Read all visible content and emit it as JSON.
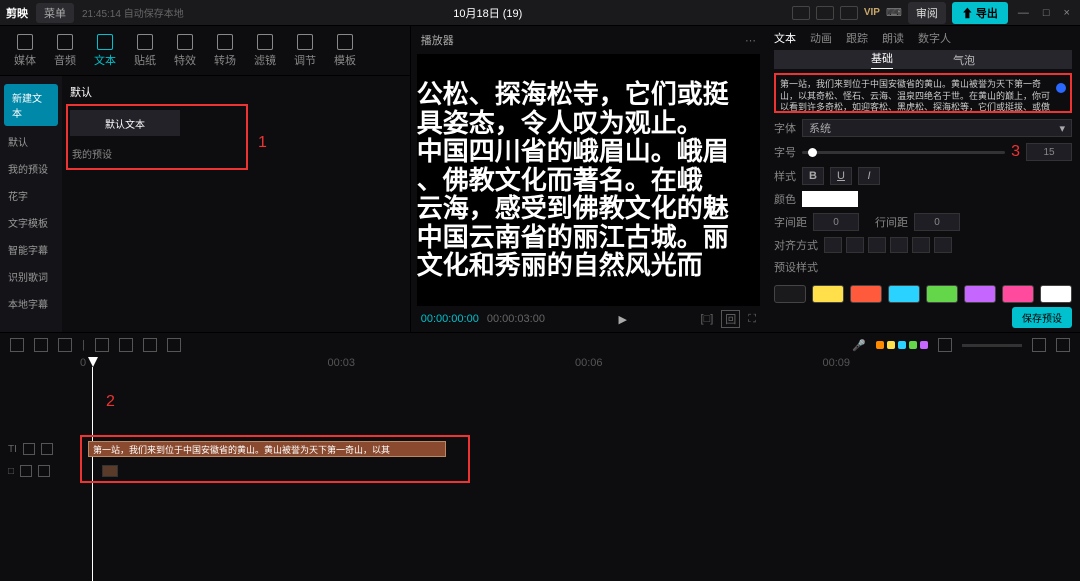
{
  "titlebar": {
    "logo": "剪映",
    "menu": "菜单",
    "autosave": "21:45:14 自动保存本地",
    "title": "10月18日 (19)",
    "vip": "VIP",
    "review": "审阅",
    "export": "导出"
  },
  "toolTabs": [
    "媒体",
    "音频",
    "文本",
    "贴纸",
    "特效",
    "转场",
    "滤镜",
    "调节",
    "模板"
  ],
  "toolActiveIndex": 2,
  "sideNav": [
    "新建文本",
    "默认",
    "我的预设",
    "花字",
    "文字模板",
    "智能字幕",
    "识别歌词",
    "本地字幕"
  ],
  "leftMain": {
    "tab": "默认",
    "card": "默认文本",
    "preset": "我的预设",
    "marker": "1"
  },
  "preview": {
    "title": "播放器",
    "lines": [
      "公松、探海松寺，它们或挺",
      "具姿态，令人叹为观止。",
      "中国四川省的峨眉山。峨眉",
      "、佛教文化而著名。在峨",
      "云海，感受到佛教文化的魅",
      "中国云南省的丽江古城。丽",
      "文化和秀丽的自然风光而"
    ],
    "cur": "00:00:00:00",
    "total": "00:00:03:00"
  },
  "right": {
    "tabs": [
      "文本",
      "动画",
      "跟踪",
      "朗读",
      "数字人"
    ],
    "sub1": "基础",
    "sub2": "气泡",
    "text": "第一站，我们来到位于中国安徽省的黄山。黄山被誉为天下第一奇山，以其奇松、怪石、云海、温泉四绝名于世。在黄山的巅上，你可以看到许多奇松，如迎客松、黑虎松、探海松等，它们或挺拔、或傲立、或横卧，各具姿态，令人叹为观止。\n第二站，我们来到位于中国四川省的峨眉山。峨眉山是中国佛教的四大名山",
    "fontLabel": "字体",
    "fontValue": "系统",
    "sizeLabel": "字号",
    "sizeValue": "15",
    "styleLabel": "样式",
    "colorLabel": "颜色",
    "spacingLabel": "字间距",
    "spacingValue": "0",
    "lineLabel": "行间距",
    "lineValue": "0",
    "alignLabel": "对齐方式",
    "presetLabel": "预设样式",
    "savePreset": "保存预设",
    "marker": "3",
    "presetColors": [
      "#1a1a1d",
      "#ffe04a",
      "#ff5a3c",
      "#2ad3ff",
      "#63d64a",
      "#c566ff",
      "#ff4a9e",
      "#ffffff"
    ]
  },
  "timeline": {
    "marker": "2",
    "ruler": [
      "0",
      "00:03",
      "00:06",
      "00:09"
    ],
    "clipText": "第一站，我们来到位于中国安徽省的黄山。黄山被誉为天下第一奇山，以其",
    "trackColors": [
      "#ff8a00",
      "#ffe04a",
      "#2ad3ff",
      "#63d64a",
      "#c566ff"
    ]
  }
}
